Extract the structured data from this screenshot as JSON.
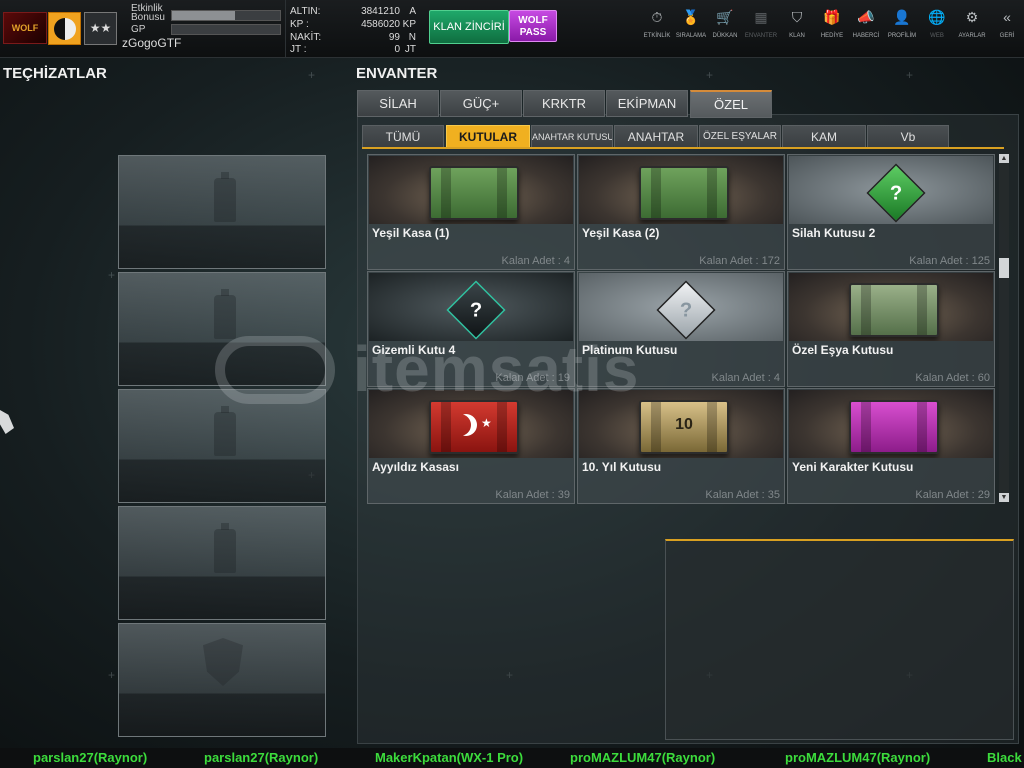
{
  "player": {
    "clan_logo_text": "WOLF",
    "rank_text": "★★",
    "bonus_label": "Etkinlik Bonusu",
    "gp_label": "GP",
    "username": "zGogoGTF",
    "bonus_fill": 0.58,
    "gp_fill": 0.0
  },
  "currency": [
    {
      "label": "ALTIN:",
      "value": "3841210",
      "unit": "A"
    },
    {
      "label": "KP  :",
      "value": "4586020",
      "unit": "KP"
    },
    {
      "label": "NAKİT:",
      "value": "99",
      "unit": "N"
    },
    {
      "label": "JT  :",
      "value": "0",
      "unit": "JT"
    }
  ],
  "buttons": {
    "klan_zinciri": "KLAN ZİNCİRİ",
    "wolf_pass_1": "WOLF",
    "wolf_pass_2": "PASS"
  },
  "menu": [
    {
      "label": "ETKİNLİK",
      "icon": "stopwatch-icon",
      "glyph": "⏱"
    },
    {
      "label": "SIRALAMA",
      "icon": "medal-icon",
      "glyph": "🏅"
    },
    {
      "label": "DÜKKAN",
      "icon": "cart-icon",
      "glyph": "🛒"
    },
    {
      "label": "ENVANTER",
      "icon": "inventory-icon",
      "glyph": "▦"
    },
    {
      "label": "KLAN",
      "icon": "shield-icon",
      "glyph": "⛉"
    },
    {
      "label": "HEDİYE",
      "icon": "gift-icon",
      "glyph": "🎁"
    },
    {
      "label": "HABERCİ",
      "icon": "megaphone-icon",
      "glyph": "📣"
    },
    {
      "label": "PROFİLİM",
      "icon": "profile-icon",
      "glyph": "👤"
    },
    {
      "label": "WEB",
      "icon": "globe-icon",
      "glyph": "🌐"
    },
    {
      "label": "AYARLAR",
      "icon": "gear-icon",
      "glyph": "⚙"
    },
    {
      "label": "GERİ",
      "icon": "back-icon",
      "glyph": "«"
    }
  ],
  "equipment": {
    "title": "TEÇHİZATLAR"
  },
  "inventory": {
    "title": "ENVANTER",
    "tabs": [
      "SİLAH",
      "GÜÇ+",
      "KRKTR",
      "EKİPMAN",
      "ÖZEL"
    ],
    "active_tab": "ÖZEL",
    "subtabs": [
      "TÜMÜ",
      "KUTULAR",
      "ANAHTAR KUTUSU",
      "ANAHTAR",
      "ÖZEL EŞYALAR",
      "KAM",
      "Vb"
    ],
    "active_subtab": "KUTULAR",
    "items": [
      {
        "name": "Yeşil Kasa (1)",
        "count": "Kalan Adet : 4"
      },
      {
        "name": "Yeşil Kasa (2)",
        "count": "Kalan Adet : 172"
      },
      {
        "name": "Silah Kutusu 2",
        "count": "Kalan Adet : 125"
      },
      {
        "name": "Gizemli Kutu 4",
        "count": "Kalan Adet : 19"
      },
      {
        "name": "Platinum Kutusu",
        "count": "Kalan Adet : 4"
      },
      {
        "name": "Özel Eşya Kutusu",
        "count": "Kalan Adet : 60"
      },
      {
        "name": "Ayyıldız Kasası",
        "count": "Kalan Adet : 39"
      },
      {
        "name": "10. Yıl Kutusu",
        "count": "Kalan Adet : 35"
      },
      {
        "name": "Yeni Karakter Kutusu",
        "count": "Kalan Adet : 29"
      }
    ],
    "gold_box_text": "10"
  },
  "ticker": [
    "parslan27(Raynor)",
    "parslan27(Raynor)",
    "MakerKpatan(WX-1 Pro)",
    "proMAZLUM47(Raynor)",
    "proMAZLUM47(Raynor)",
    "Black"
  ],
  "watermark": "itemsatis",
  "colors": {
    "accent_yellow": "#f0b020",
    "tab_accent": "#d58b3a",
    "klan_green": "#1fa86a",
    "wolf_purple": "#c64ae2",
    "ticker_green": "#3cdc3c"
  }
}
